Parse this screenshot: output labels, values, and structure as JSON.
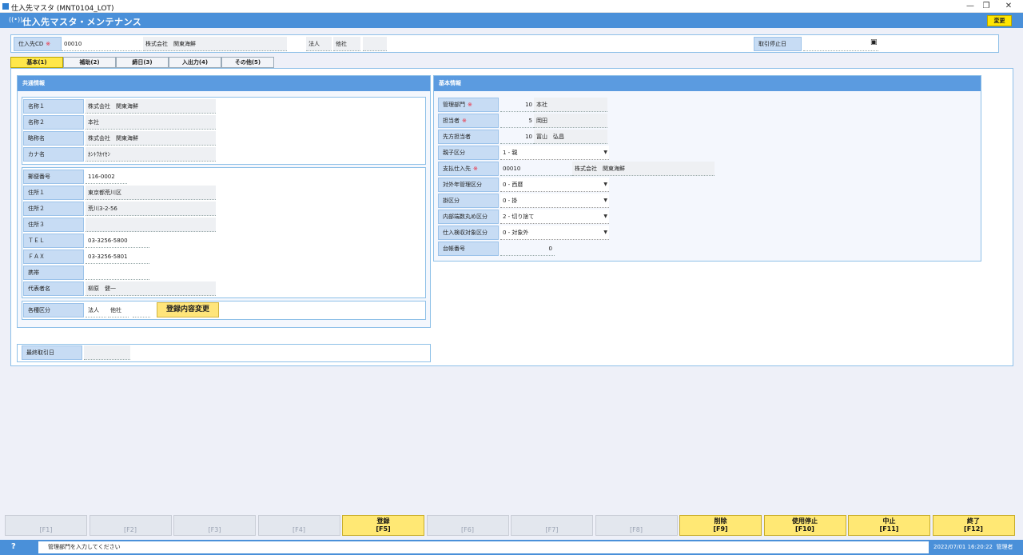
{
  "window": {
    "title": "仕入先マスタ (MNT0104_LOT)",
    "min": "—",
    "restore": "❐",
    "close": "✕"
  },
  "header": {
    "title": "仕入先マスタ・メンテナンス",
    "icon": "((•))",
    "change_button": "変更"
  },
  "top": {
    "supplier_cd_label": "仕入先CD",
    "required_mark": "※",
    "supplier_cd": "00010",
    "supplier_name": "株式会社　関東海鮮",
    "corp_type": "法人",
    "other": "他社",
    "stop_date_label": "取引停止日",
    "stop_date": "",
    "calendar_icon": "▣"
  },
  "tabs": [
    "基本(1)",
    "補助(2)",
    "締日(3)",
    "入出力(4)",
    "その他(5)"
  ],
  "common": {
    "heading": "共通情報",
    "names": [
      {
        "label": "名称１",
        "value": "株式会社　関東海鮮"
      },
      {
        "label": "名称２",
        "value": "本社"
      },
      {
        "label": "略称名",
        "value": "株式会社　関東海鮮"
      },
      {
        "label": "カナ名",
        "value": "ｶﾝﾄｳｶｲｾﾝ"
      }
    ],
    "address": [
      {
        "label": "郵便番号",
        "value": "116-0002"
      },
      {
        "label": "住所１",
        "value": "東京都荒川区"
      },
      {
        "label": "住所２",
        "value": "荒川3-2-56"
      },
      {
        "label": "住所３",
        "value": ""
      },
      {
        "label": "ＴＥＬ",
        "value": "03-3256-5800"
      },
      {
        "label": "ＦＡＸ",
        "value": "03-3256-5801"
      },
      {
        "label": "携帯",
        "value": ""
      },
      {
        "label": "代表者名",
        "value": "柳原　健一"
      }
    ],
    "kinds_label": "各種区分",
    "kinds_v1": "法人",
    "kinds_v2": "他社",
    "register_change_button": "登録内容変更",
    "last_trade_label": "最終取引日",
    "last_trade": ""
  },
  "basic": {
    "heading": "基本情報",
    "dept_label": "管理部門",
    "dept_code": "10",
    "dept_name": "本社",
    "staff_label": "担当者",
    "staff_code": "5",
    "staff_name": "岡田",
    "peer_staff_label": "先方担当者",
    "peer_staff_code": "10",
    "peer_staff_name": "冨山　弘昌",
    "parent_label": "親子区分",
    "parent_value": "1 - 親",
    "pay_label": "支払仕入先",
    "pay_code": "00010",
    "pay_name": "株式会社　関東海鮮",
    "era_label": "対外年管理区分",
    "era_value": "0 - 西暦",
    "credit_label": "掛区分",
    "credit_value": "0 - 掛",
    "rounding_label": "内部端数丸め区分",
    "rounding_value": "2 - 切り捨て",
    "inspect_label": "仕入検収対象区分",
    "inspect_value": "0 - 対象外",
    "ledger_label": "台帳番号",
    "ledger_value": "0"
  },
  "fkeys": [
    {
      "label": "",
      "key": "[F1]",
      "on": false
    },
    {
      "label": "",
      "key": "[F2]",
      "on": false
    },
    {
      "label": "",
      "key": "[F3]",
      "on": false
    },
    {
      "label": "",
      "key": "[F4]",
      "on": false
    },
    {
      "label": "登録",
      "key": "[F5]",
      "on": true
    },
    {
      "label": "",
      "key": "[F6]",
      "on": false
    },
    {
      "label": "",
      "key": "[F7]",
      "on": false
    },
    {
      "label": "",
      "key": "[F8]",
      "on": false
    },
    {
      "label": "削除",
      "key": "[F9]",
      "on": true
    },
    {
      "label": "使用停止",
      "key": "[F10]",
      "on": true
    },
    {
      "label": "中止",
      "key": "[F11]",
      "on": true
    },
    {
      "label": "終了",
      "key": "[F12]",
      "on": true
    }
  ],
  "status": {
    "help": "?",
    "message": "管理部門を入力してください",
    "datetime": "2022/07/01 16:20:22",
    "user": "管理者"
  }
}
